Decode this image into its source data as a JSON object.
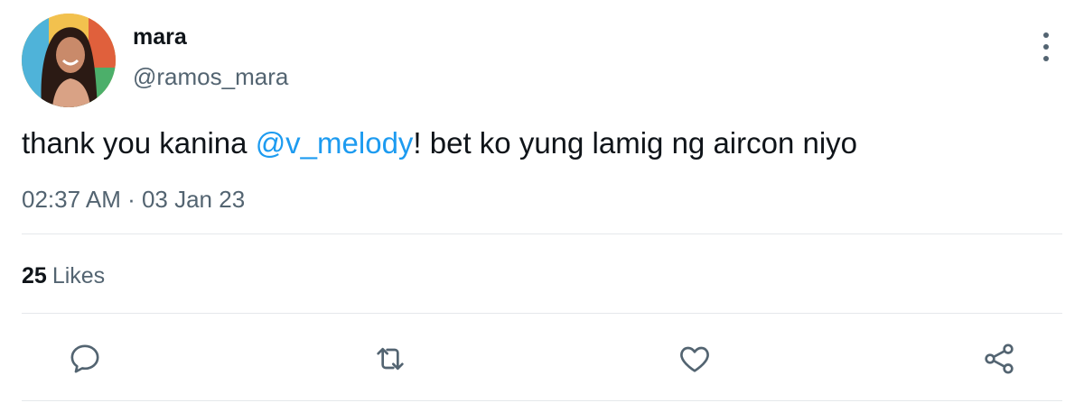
{
  "author": {
    "display_name": "mara",
    "handle": "@ramos_mara",
    "avatar": "profile-photo"
  },
  "tweet": {
    "text_before": "thank you kanina ",
    "mention": "@v_melody",
    "text_after": "! bet ko yung lamig ng aircon niyo",
    "timestamp": "02:37 AM · 03 Jan 23"
  },
  "stats": {
    "likes_count": "25",
    "likes_label": "Likes"
  },
  "actions": [
    {
      "name": "reply",
      "icon": "comment-icon"
    },
    {
      "name": "retweet",
      "icon": "retweet-icon"
    },
    {
      "name": "like",
      "icon": "heart-icon"
    },
    {
      "name": "share",
      "icon": "share-icon"
    }
  ],
  "colors": {
    "mention": "#1d9bf0",
    "secondary_text": "#536471",
    "primary_text": "#0f1419",
    "divider": "#e5e8eb"
  }
}
